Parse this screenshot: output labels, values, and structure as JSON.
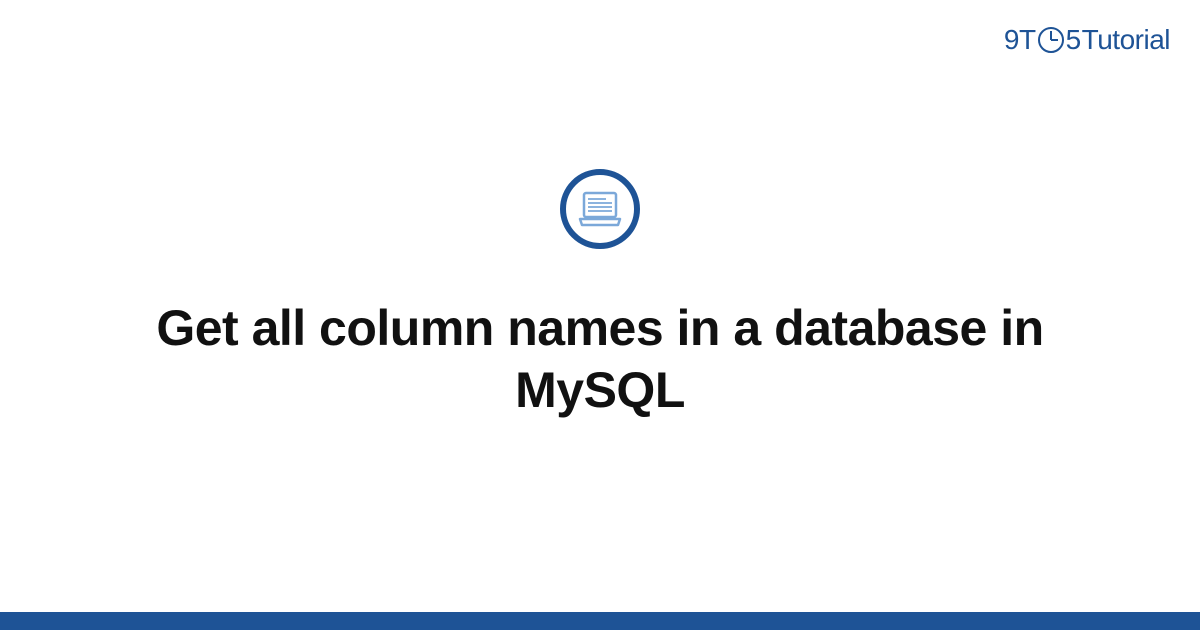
{
  "brand": {
    "prefix": "9T",
    "suffix": "5",
    "word": "Tutorial"
  },
  "main": {
    "title": "Get all column names in a database in MySQL"
  },
  "colors": {
    "primary": "#1e5396",
    "text": "#111111"
  }
}
